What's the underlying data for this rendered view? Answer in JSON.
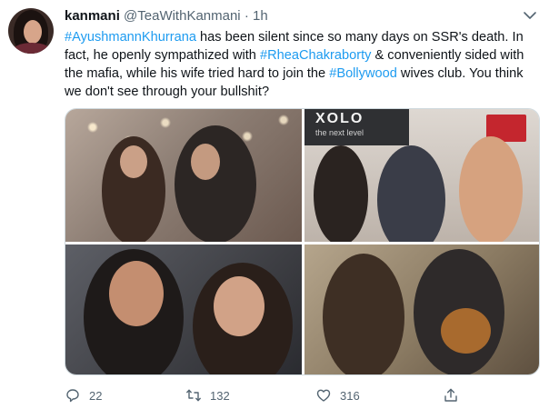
{
  "tweet": {
    "display_name": "kanmani",
    "handle": "@TeaWithKanmani",
    "separator": "·",
    "time": "1h",
    "text_segments": [
      {
        "text": "#AyushmannKhurrana",
        "type": "hashtag"
      },
      {
        "text": " has been silent since so many days on SSR's death. In fact, he openly sympathized with ",
        "type": "plain"
      },
      {
        "text": "#RheaChakraborty",
        "type": "hashtag"
      },
      {
        "text": " & conveniently sided with the mafia, while his wife tried hard to join the ",
        "type": "plain"
      },
      {
        "text": "#Bollywood",
        "type": "hashtag"
      },
      {
        "text": " wives club. You think we don't see through your bullshit?",
        "type": "plain"
      }
    ],
    "media": {
      "photos": [
        {
          "name": "photo-couple-embrace"
        },
        {
          "name": "photo-xolo-event",
          "brand": "XOLO",
          "brand_tagline": "the next level"
        },
        {
          "name": "photo-couple-selfie"
        },
        {
          "name": "photo-guitar-scene"
        }
      ]
    },
    "actions": {
      "reply": {
        "icon": "reply-icon",
        "count": "22"
      },
      "retweet": {
        "icon": "retweet-icon",
        "count": "132"
      },
      "like": {
        "icon": "heart-icon",
        "count": "316"
      },
      "share": {
        "icon": "share-icon"
      }
    },
    "colors": {
      "accent": "#1d9bf0",
      "secondary_text": "#536471",
      "primary_text": "#0f1419"
    }
  }
}
